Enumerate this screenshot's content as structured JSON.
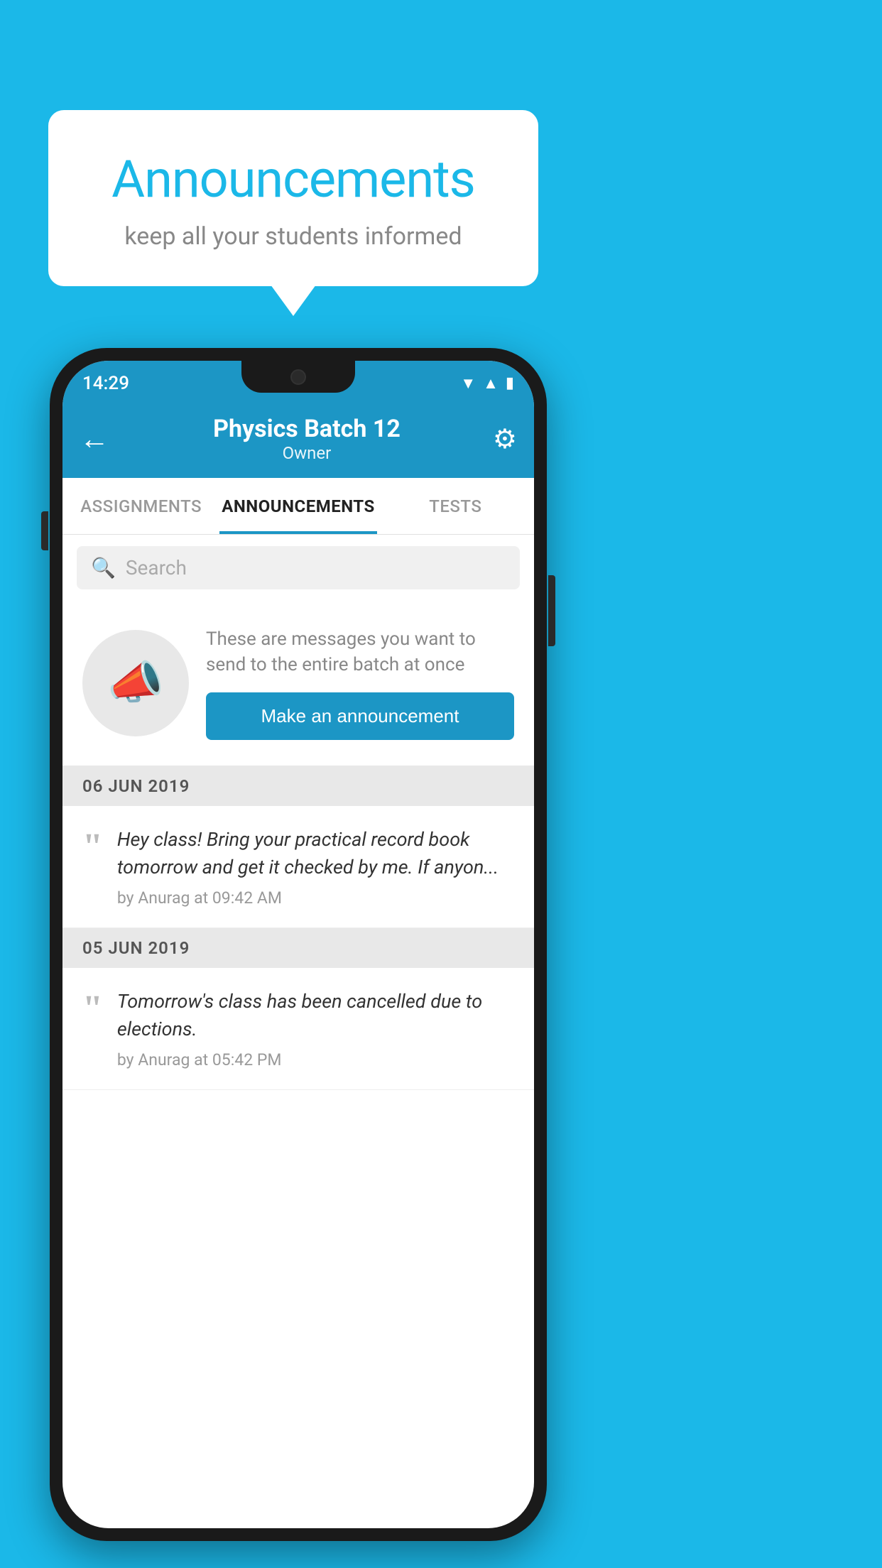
{
  "background_color": "#1BB8E8",
  "speech_bubble": {
    "title": "Announcements",
    "subtitle": "keep all your students informed"
  },
  "phone": {
    "status_bar": {
      "time": "14:29",
      "icons": [
        "wifi",
        "signal",
        "battery"
      ]
    },
    "app_bar": {
      "title": "Physics Batch 12",
      "subtitle": "Owner",
      "back_label": "←",
      "settings_label": "⚙"
    },
    "tabs": [
      {
        "label": "ASSIGNMENTS",
        "active": false
      },
      {
        "label": "ANNOUNCEMENTS",
        "active": true
      },
      {
        "label": "TESTS",
        "active": false
      }
    ],
    "search": {
      "placeholder": "Search"
    },
    "cta": {
      "description": "These are messages you want to send to the entire batch at once",
      "button_label": "Make an announcement"
    },
    "announcements": [
      {
        "date": "06  JUN  2019",
        "items": [
          {
            "text": "Hey class! Bring your practical record book tomorrow and get it checked by me. If anyon...",
            "meta": "by Anurag at 09:42 AM"
          }
        ]
      },
      {
        "date": "05  JUN  2019",
        "items": [
          {
            "text": "Tomorrow's class has been cancelled due to elections.",
            "meta": "by Anurag at 05:42 PM"
          }
        ]
      }
    ]
  }
}
